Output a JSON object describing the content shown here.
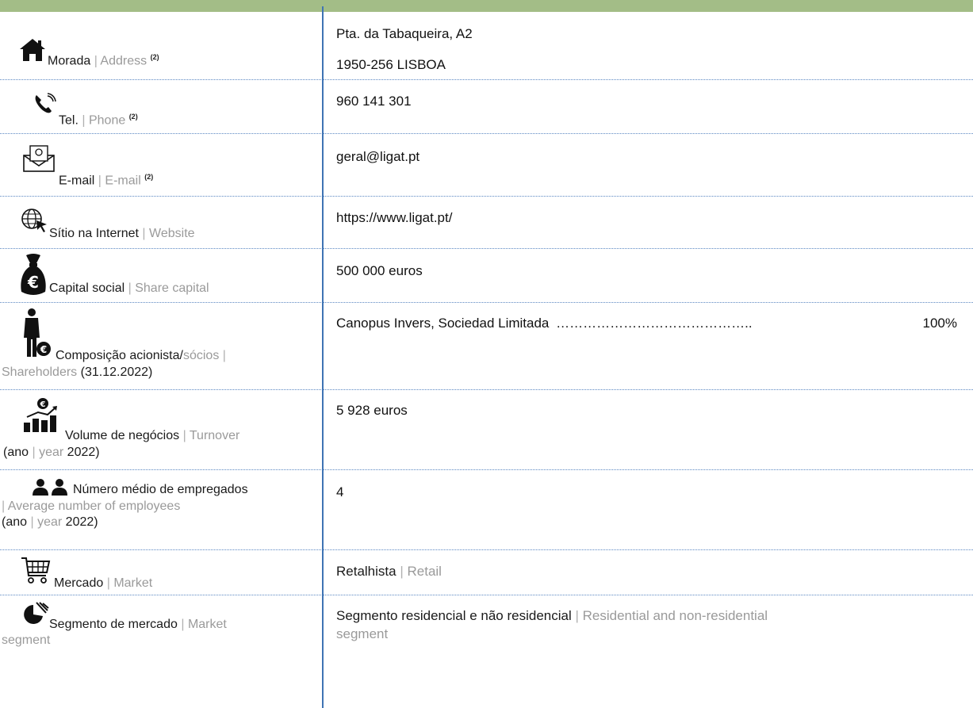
{
  "rows": {
    "address": {
      "pt": "Morada",
      "sep": "|",
      "en": "Address",
      "note": "(2)",
      "value_line1": "Pta. da Tabaqueira, A2",
      "value_line2": "1950-256 LISBOA"
    },
    "phone": {
      "pt": "Tel.",
      "sep": "|",
      "en": "Phone",
      "note": "(2)",
      "value": "960 141 301"
    },
    "email": {
      "pt": "E-mail",
      "sep": "|",
      "en": "E-mail",
      "note": "(2)",
      "value": "geral@ligat.pt"
    },
    "website": {
      "pt": "Sítio na Internet",
      "sep": "|",
      "en": "Website",
      "value": "https://www.ligat.pt/"
    },
    "capital": {
      "pt": "Capital social",
      "sep": "|",
      "en": "Share capital",
      "value": "500 000 euros"
    },
    "shareholders": {
      "pt": "Composição acionista/",
      "pt_en": "sócios",
      "sep": "|",
      "en": "Shareholders",
      "date": "(31.12.2022)",
      "holder": "Canopus Invers, Sociedad Limitada",
      "leader": "……………………………………..",
      "pct": "100%"
    },
    "turnover": {
      "pt": "Volume de negócios",
      "sep": "|",
      "en": "Turnover",
      "open": "(ano",
      "sep2": "|",
      "year_en": "year",
      "year": "2022)",
      "value": "5 928 euros"
    },
    "employees": {
      "pt": "Número médio de empregados",
      "sep": "|",
      "en": "Average number of employees",
      "open": "(ano",
      "sep2": "|",
      "year_en": "year",
      "year": "2022)",
      "value": "4"
    },
    "market": {
      "pt": "Mercado",
      "sep": "|",
      "en": "Market",
      "value_pt": "Retalhista",
      "value_sep": "|",
      "value_en": "Retail"
    },
    "segment": {
      "pt": "Segmento de mercado",
      "sep": "|",
      "en": "Market",
      "en2": "segment",
      "value_pt": "Segmento residencial e não residencial",
      "value_sep": "|",
      "value_en": "Residential and non-residential",
      "value_en2": "segment"
    }
  },
  "icons": [
    "house-icon",
    "phone-icon",
    "email-icon",
    "globe-cursor-icon",
    "money-bag-icon",
    "person-money-icon",
    "chart-money-icon",
    "people-icon",
    "shopping-cart-icon",
    "pie-segment-icon"
  ]
}
